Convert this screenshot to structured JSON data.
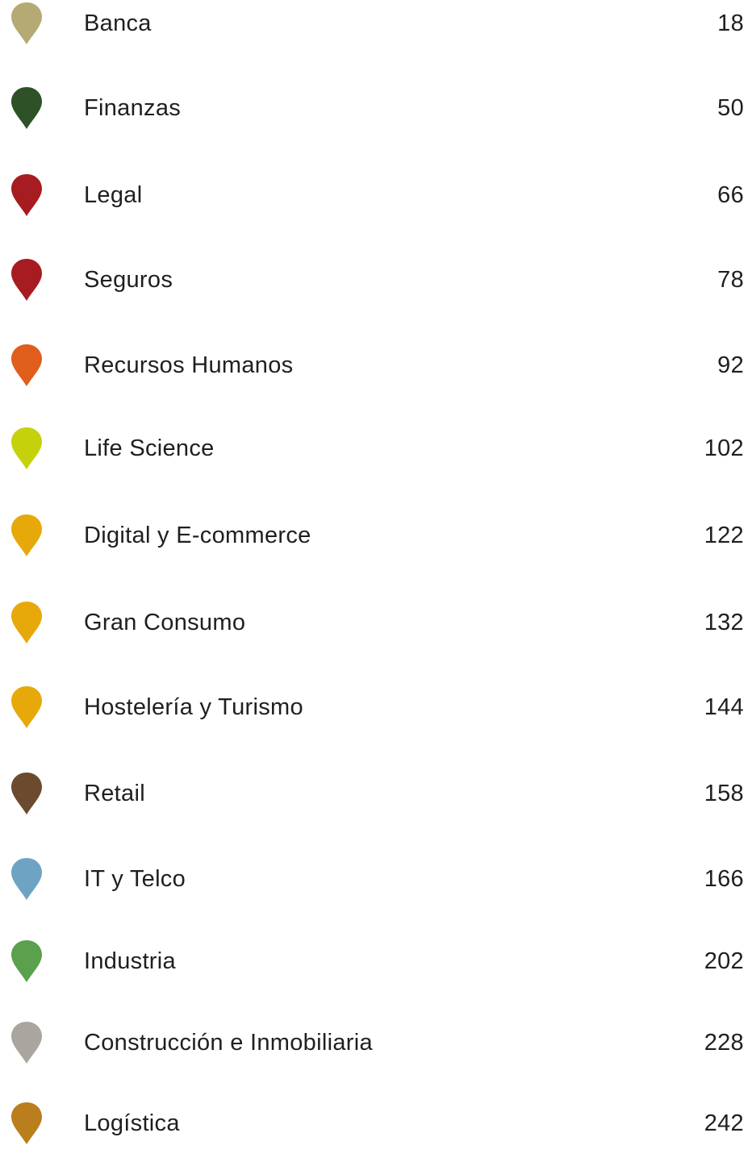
{
  "entries": [
    {
      "label": "Banca",
      "page": "18",
      "color": "#B5A974"
    },
    {
      "label": "Finanzas",
      "page": "50",
      "color": "#2E5128"
    },
    {
      "label": "Legal",
      "page": "66",
      "color": "#A61C21"
    },
    {
      "label": "Seguros",
      "page": "78",
      "color": "#A61C21"
    },
    {
      "label": "Recursos Humanos",
      "page": "92",
      "color": "#DF5E1C"
    },
    {
      "label": "Life Science",
      "page": "102",
      "color": "#C5D10B"
    },
    {
      "label": "Digital y E-commerce",
      "page": "122",
      "color": "#E7A90A"
    },
    {
      "label": "Gran Consumo",
      "page": "132",
      "color": "#E7A90A"
    },
    {
      "label": "Hostelería y Turismo",
      "page": "144",
      "color": "#E7A90A"
    },
    {
      "label": "Retail",
      "page": "158",
      "color": "#6B4A2D"
    },
    {
      "label": "IT y Telco",
      "page": "166",
      "color": "#6FA3C3"
    },
    {
      "label": "Industria",
      "page": "202",
      "color": "#5AA04D"
    },
    {
      "label": "Construcción e Inmobiliaria",
      "page": "228",
      "color": "#ABA5A0"
    },
    {
      "label": "Logística",
      "page": "242",
      "color": "#BA7E1C"
    }
  ],
  "icon": "map-pin-icon"
}
